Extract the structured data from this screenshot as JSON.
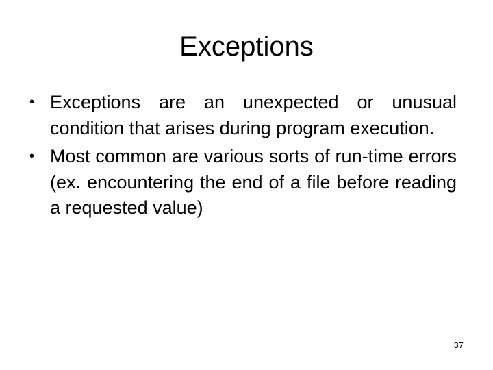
{
  "slide": {
    "title": "Exceptions",
    "bullets": [
      {
        "marker": "•",
        "text": "Exceptions are an unexpected or unusual condition that arises during program execution."
      },
      {
        "marker": "•",
        "text": "Most common are various sorts of run-time errors (ex. encountering the end of a file before reading a requested value)"
      }
    ],
    "page_number": "37"
  }
}
